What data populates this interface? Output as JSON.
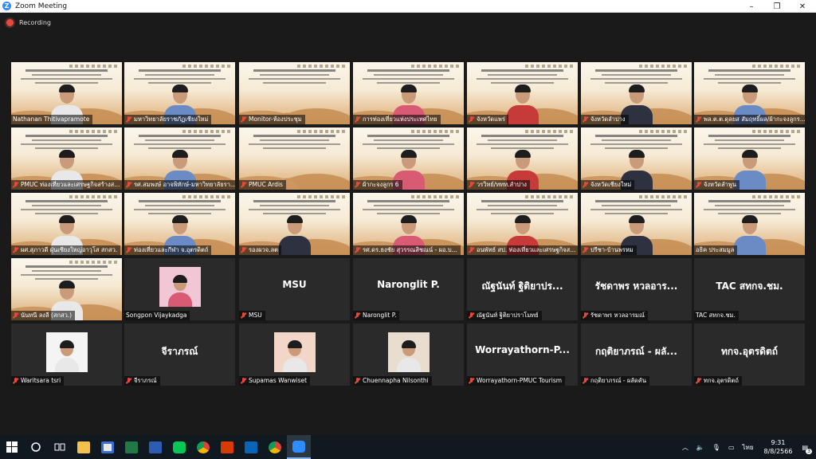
{
  "window": {
    "title": "Zoom Meeting",
    "minimize": "–",
    "maximize": "❐",
    "close": "✕"
  },
  "recording": {
    "label": "Recording"
  },
  "tiles": [
    {
      "name": "Nathanan Thitivapramote",
      "mic": false
    },
    {
      "name": "มหาวิทยาลัยราชภัฏเชียงใหม่",
      "mic": true
    },
    {
      "name": "Monitor-ห้องประชุม",
      "mic": true
    },
    {
      "name": "การท่องเที่ยวแห่งประเทศไทย",
      "mic": true
    },
    {
      "name": "จังหวัดแพร่",
      "mic": true
    },
    {
      "name": "จังหวัดลำปาง",
      "mic": true
    },
    {
      "name": "พล.ต.ต.ดุลยส สัมฤทธิ์ผล/ผ้ากะจงลูกร...",
      "mic": true
    },
    {
      "name": "PMUC ท่องเที่ยวและเศรษฐกิจสร้างส...",
      "mic": true
    },
    {
      "name": "รศ.สมพงษ์ อาจพิทักษ์-มหาวิทยาลัยรา...",
      "mic": true
    },
    {
      "name": "PMUC Ardis",
      "mic": true
    },
    {
      "name": "ผ้ากะจงลูกร 6",
      "mic": true
    },
    {
      "name": "วรวิทย์/ททท.ลำปาง",
      "mic": true
    },
    {
      "name": "จังหวัดเชียงใหม่",
      "mic": true
    },
    {
      "name": "จังหวัดลำพูน",
      "mic": true
    },
    {
      "name": "ผศ.สุภาวดี ฝุ่นเซียงใหญ่อาวุโส สกสว.",
      "mic": true
    },
    {
      "name": "ท่องเที่ยวและกีฬา จ.อุตรดิตถ์",
      "mic": true
    },
    {
      "name": "รองผวจ.ลต",
      "mic": true
    },
    {
      "name": "รศ.ดร.ธงชัย สุวรรณสิชณน์ - ผอ.บ...",
      "mic": true
    },
    {
      "name": "อนพัทธ์ สป. ท่องเที่ยวและเศรษฐกิจส...",
      "mic": true
    },
    {
      "name": "ปรีชา-บ้านพรหม",
      "mic": true
    },
    {
      "name": "อธิค ประสมมูล",
      "mic": false
    },
    {
      "name": "นันทนี ลงลี (สกสว.)",
      "mic": true
    },
    {
      "name": "Songpon Vijaykadga",
      "mic": false
    },
    {
      "name": "MSU",
      "mic": true,
      "big": "MSU"
    },
    {
      "name": "Naronglit P.",
      "mic": true,
      "big": "Naronglit P."
    },
    {
      "name": "ณัฐนันท์ ฐิติยาปราโมทย์",
      "mic": true,
      "big": "ณัฐนันท์ ฐิติยาปร..."
    },
    {
      "name": "รัชดาพร หวลอารมณ์",
      "mic": true,
      "big": "รัชดาพร หวลอาร..."
    },
    {
      "name": "TAC สทกจ.ชม.",
      "mic": false,
      "big": "TAC สทกจ.ชม."
    },
    {
      "name": "Waritsara tsri",
      "mic": true
    },
    {
      "name": "จีราภรณ์",
      "mic": true,
      "big": "จีราภรณ์"
    },
    {
      "name": "Supamas Wanwiset",
      "mic": true
    },
    {
      "name": "Chuennapha Nilsonthi",
      "mic": true
    },
    {
      "name": "Worrayathorn-PMUC Tourism",
      "mic": true,
      "big": "Worrayathorn-P..."
    },
    {
      "name": "กฤติยาภรณ์ - ผลัดคัน",
      "mic": true,
      "big": "กฤติยาภรณ์ - ผลั..."
    },
    {
      "name": "ทกจ.อุตรดิตถ์",
      "mic": true,
      "big": "ทกจ.อุตรดิตถ์"
    }
  ],
  "taskbar": {
    "lang": "ไทย",
    "time": "9:31",
    "date": "8/8/2566",
    "notifications": "3",
    "icons": [
      "windows-start-icon",
      "search-icon",
      "task-view-icon",
      "file-explorer-icon",
      "store-icon",
      "excel-icon",
      "word-icon",
      "line-icon",
      "chrome-icon",
      "office-icon",
      "mail-icon",
      "chrome-profile-icon",
      "zoom-icon"
    ]
  }
}
